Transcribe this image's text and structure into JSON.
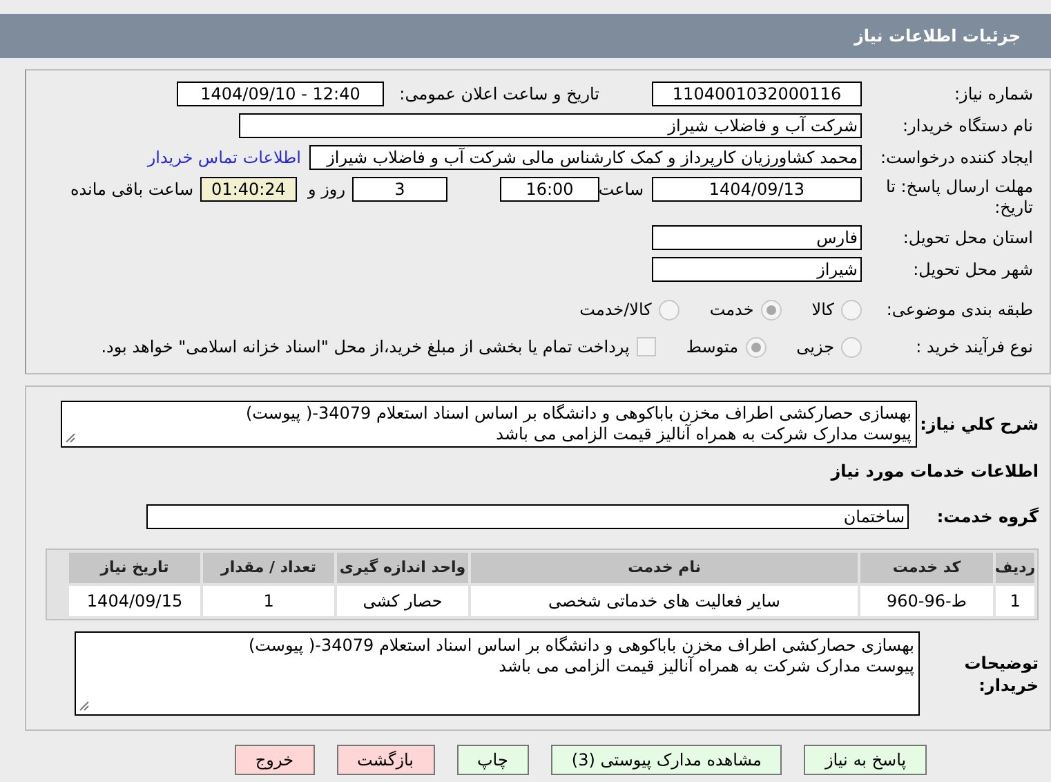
{
  "header": {
    "title": "جزئیات اطلاعات نیاز"
  },
  "need_info": {
    "need_number": {
      "label": "شماره نیاز:",
      "value": "1104001032000116"
    },
    "announce": {
      "label": "تاریخ و ساعت اعلان عمومی:",
      "value": "1404/09/10 - 12:40"
    },
    "buyer_org": {
      "label": "نام دستگاه خریدار:",
      "value": "شرکت آب و فاضلاب شیراز"
    },
    "requester": {
      "label": "ایجاد کننده درخواست:",
      "value": "محمد کشاورزیان کارپرداز و کمک کارشناس مالی شرکت آب و فاضلاب شیراز",
      "link": "اطلاعات تماس خریدار"
    },
    "deadline": {
      "label": "مهلت ارسال پاسخ: تا تاریخ:",
      "date": "1404/09/13",
      "time_label": "ساعت",
      "time": "16:00",
      "days": "3",
      "days_label": "روز و",
      "remaining": "01:40:24",
      "remaining_label": "ساعت باقی مانده"
    },
    "province": {
      "label": "استان محل تحویل:",
      "value": "فارس"
    },
    "city": {
      "label": "شهر محل تحویل:",
      "value": "شیراز"
    },
    "category": {
      "label": "طبقه بندی موضوعی:",
      "options": [
        {
          "label": "کالا",
          "selected": false
        },
        {
          "label": "خدمت",
          "selected": true
        },
        {
          "label": "کالا/خدمت",
          "selected": false
        }
      ]
    },
    "process": {
      "label": "نوع فرآیند خرید :",
      "options": [
        {
          "label": "جزیی",
          "selected": false
        },
        {
          "label": "متوسط",
          "selected": true
        }
      ],
      "treasury": {
        "label": "پرداخت تمام یا بخشی از مبلغ خرید،از محل \"اسناد خزانه اسلامی\" خواهد بود.",
        "checked": false
      }
    }
  },
  "details": {
    "summary": {
      "label": "شرح کلي نياز:",
      "lines": [
        "بهسازی حصارکشی اطراف مخزن باباکوهی و دانشگاه بر اساس اسناد استعلام 34079-( پیوست)",
        "پیوست مدارک شرکت به همراه آنالیز قیمت الزامی می باشد"
      ]
    },
    "services_heading": "اطلاعات خدمات مورد نیاز",
    "service_group": {
      "label": "گروه خدمت:",
      "value": "ساختمان"
    },
    "table": {
      "columns": [
        "ردیف",
        "کد خدمت",
        "نام خدمت",
        "واحد اندازه گیری",
        "تعداد / مقدار",
        "تاریخ نیاز"
      ],
      "rows": [
        [
          "1",
          "ط-96-960",
          "سایر فعالیت های خدماتی شخصی",
          "حصار کشی",
          "1",
          "1404/09/15"
        ]
      ]
    },
    "buyer_notes": {
      "label": "توضیحات خریدار:",
      "lines": [
        "بهسازی حصارکشی اطراف مخزن باباکوهی و دانشگاه بر اساس اسناد استعلام 34079-( پیوست)",
        "پیوست مدارک شرکت به همراه آنالیز قیمت الزامی می باشد"
      ]
    }
  },
  "buttons": [
    {
      "label": "پاسخ به نیاز",
      "kind": "action"
    },
    {
      "label": "مشاهده مدارک پیوستی (3)",
      "kind": "action"
    },
    {
      "label": "چاپ",
      "kind": "action"
    },
    {
      "label": "بازگشت",
      "kind": "exit"
    },
    {
      "label": "خروج",
      "kind": "exit"
    }
  ]
}
